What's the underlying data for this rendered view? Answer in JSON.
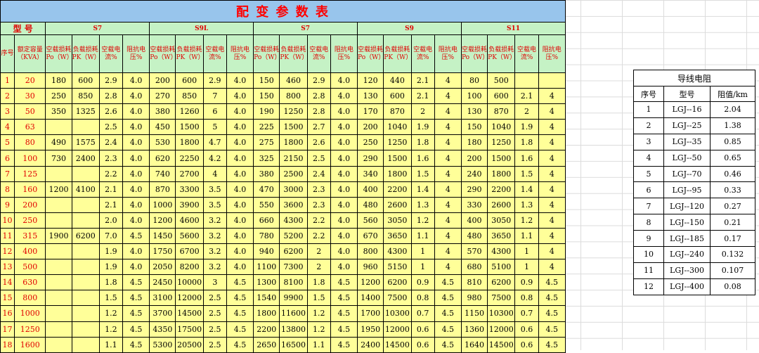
{
  "title": "配 变 参 数 表",
  "header": {
    "model_label": "型 号",
    "index_label": "序号",
    "capacity_label": "额定容量（KVA）",
    "series": [
      "S7",
      "S9L",
      "S7",
      "S9",
      "S11"
    ],
    "sub_cols": [
      "空载损耗 Po（W）",
      "负载损耗 PK（W）",
      "空载电流%",
      "阻抗电压%"
    ]
  },
  "rows": [
    {
      "idx": "1",
      "cap": "20",
      "v": [
        "180",
        "600",
        "2.9",
        "4.0",
        "200",
        "600",
        "2.9",
        "4.0",
        "150",
        "460",
        "2.9",
        "4.0",
        "120",
        "440",
        "2.1",
        "4",
        "80",
        "500",
        "",
        ""
      ]
    },
    {
      "idx": "2",
      "cap": "30",
      "v": [
        "250",
        "850",
        "2.8",
        "4.0",
        "270",
        "850",
        "7",
        "4.0",
        "150",
        "800",
        "2.8",
        "4.0",
        "130",
        "600",
        "2.1",
        "4",
        "100",
        "600",
        "2.1",
        "4"
      ]
    },
    {
      "idx": "3",
      "cap": "50",
      "v": [
        "350",
        "1325",
        "2.6",
        "4.0",
        "380",
        "1260",
        "6",
        "4.0",
        "190",
        "1250",
        "2.8",
        "4.0",
        "170",
        "870",
        "2",
        "4",
        "130",
        "870",
        "2",
        "4"
      ]
    },
    {
      "idx": "4",
      "cap": "63",
      "v": [
        "",
        "",
        "2.5",
        "4.0",
        "450",
        "1500",
        "5",
        "4.0",
        "225",
        "1500",
        "2.7",
        "4.0",
        "200",
        "1040",
        "1.9",
        "4",
        "150",
        "1040",
        "1.9",
        "4"
      ]
    },
    {
      "idx": "5",
      "cap": "80",
      "v": [
        "490",
        "1575",
        "2.4",
        "4.0",
        "530",
        "1800",
        "4.7",
        "4.0",
        "275",
        "1800",
        "2.6",
        "4.0",
        "250",
        "1250",
        "1.8",
        "4",
        "180",
        "1250",
        "1.8",
        "4"
      ]
    },
    {
      "idx": "6",
      "cap": "100",
      "v": [
        "730",
        "2400",
        "2.3",
        "4.0",
        "620",
        "2250",
        "4.2",
        "4.0",
        "325",
        "2150",
        "2.5",
        "4.0",
        "290",
        "1500",
        "1.6",
        "4",
        "200",
        "1500",
        "1.6",
        "4"
      ]
    },
    {
      "idx": "7",
      "cap": "125",
      "v": [
        "",
        "",
        "2.2",
        "4.0",
        "740",
        "2700",
        "4",
        "4.0",
        "380",
        "2500",
        "2.4",
        "4.0",
        "340",
        "1800",
        "1.5",
        "4",
        "240",
        "1800",
        "1.5",
        "4"
      ]
    },
    {
      "idx": "8",
      "cap": "160",
      "v": [
        "1200",
        "4100",
        "2.1",
        "4.0",
        "870",
        "3300",
        "3.5",
        "4.0",
        "470",
        "3000",
        "2.3",
        "4.0",
        "400",
        "2200",
        "1.4",
        "4",
        "290",
        "2200",
        "1.4",
        "4"
      ]
    },
    {
      "idx": "9",
      "cap": "200",
      "v": [
        "",
        "",
        "2.1",
        "4.0",
        "1000",
        "3900",
        "3.5",
        "4.0",
        "550",
        "3600",
        "2.3",
        "4.0",
        "480",
        "2600",
        "1.3",
        "4",
        "330",
        "2600",
        "1.3",
        "4"
      ]
    },
    {
      "idx": "10",
      "cap": "250",
      "v": [
        "",
        "",
        "2.0",
        "4.0",
        "1200",
        "4600",
        "3.2",
        "4.0",
        "660",
        "4300",
        "2.2",
        "4.0",
        "560",
        "3050",
        "1.2",
        "4",
        "400",
        "3050",
        "1.2",
        "4"
      ]
    },
    {
      "idx": "11",
      "cap": "315",
      "v": [
        "1900",
        "6200",
        "7.0",
        "4.5",
        "1450",
        "5600",
        "3.2",
        "4.0",
        "780",
        "5200",
        "2.2",
        "4.0",
        "670",
        "3650",
        "1.1",
        "4",
        "480",
        "3650",
        "1.1",
        "4"
      ]
    },
    {
      "idx": "12",
      "cap": "400",
      "v": [
        "",
        "",
        "1.9",
        "4.0",
        "1750",
        "6700",
        "3.2",
        "4.0",
        "940",
        "6200",
        "2",
        "4.0",
        "800",
        "4300",
        "1",
        "4",
        "570",
        "4300",
        "1",
        "4"
      ]
    },
    {
      "idx": "13",
      "cap": "500",
      "v": [
        "",
        "",
        "1.9",
        "4.0",
        "2050",
        "8200",
        "3.2",
        "4.0",
        "1100",
        "7300",
        "2",
        "4.0",
        "960",
        "5150",
        "1",
        "4",
        "680",
        "5100",
        "1",
        "4"
      ]
    },
    {
      "idx": "14",
      "cap": "630",
      "v": [
        "",
        "",
        "1.8",
        "4.5",
        "2450",
        "10000",
        "3",
        "4.5",
        "1300",
        "8100",
        "1.8",
        "4.5",
        "1200",
        "6200",
        "0.9",
        "4.5",
        "810",
        "6200",
        "0.9",
        "4.5"
      ]
    },
    {
      "idx": "15",
      "cap": "800",
      "v": [
        "",
        "",
        "1.5",
        "4.5",
        "3100",
        "12000",
        "2.5",
        "4.5",
        "1540",
        "9900",
        "1.5",
        "4.5",
        "1400",
        "7500",
        "0.8",
        "4.5",
        "980",
        "7500",
        "0.8",
        "4.5"
      ]
    },
    {
      "idx": "16",
      "cap": "1000",
      "v": [
        "",
        "",
        "1.2",
        "4.5",
        "3700",
        "14500",
        "2.5",
        "4.5",
        "1800",
        "11600",
        "1.2",
        "4.5",
        "1700",
        "10300",
        "0.7",
        "4.5",
        "1150",
        "10300",
        "0.7",
        "4.5"
      ]
    },
    {
      "idx": "17",
      "cap": "1250",
      "v": [
        "",
        "",
        "1.2",
        "4.5",
        "4350",
        "17500",
        "2.5",
        "4.5",
        "2200",
        "13800",
        "1.2",
        "4.5",
        "1950",
        "12000",
        "0.6",
        "4.5",
        "1360",
        "12000",
        "0.6",
        "4.5"
      ]
    },
    {
      "idx": "18",
      "cap": "1600",
      "v": [
        "",
        "",
        "1.1",
        "4.5",
        "5300",
        "20500",
        "2.5",
        "4.5",
        "2650",
        "16500",
        "1.1",
        "4.5",
        "2400",
        "14500",
        "0.6",
        "4.5",
        "1640",
        "14500",
        "0.6",
        "4.5"
      ]
    }
  ],
  "resistance": {
    "title": "导线电阻",
    "headers": [
      "序号",
      "型号",
      "阻值/km"
    ],
    "rows": [
      {
        "n": "1",
        "model": "LGJ--16",
        "value": "2.04"
      },
      {
        "n": "2",
        "model": "LGJ--25",
        "value": "1.38"
      },
      {
        "n": "3",
        "model": "LGJ--35",
        "value": "0.85"
      },
      {
        "n": "4",
        "model": "LGJ--50",
        "value": "0.65"
      },
      {
        "n": "5",
        "model": "LGJ--70",
        "value": "0.46"
      },
      {
        "n": "6",
        "model": "LGJ--95",
        "value": "0.33"
      },
      {
        "n": "7",
        "model": "LGJ--120",
        "value": "0.27"
      },
      {
        "n": "8",
        "model": "LGJ--150",
        "value": "0.21"
      },
      {
        "n": "9",
        "model": "LGJ--185",
        "value": "0.17"
      },
      {
        "n": "10",
        "model": "LGJ--240",
        "value": "0.132"
      },
      {
        "n": "11",
        "model": "LGJ--300",
        "value": "0.107"
      },
      {
        "n": "12",
        "model": "LGJ--400",
        "value": "0.08"
      }
    ]
  }
}
